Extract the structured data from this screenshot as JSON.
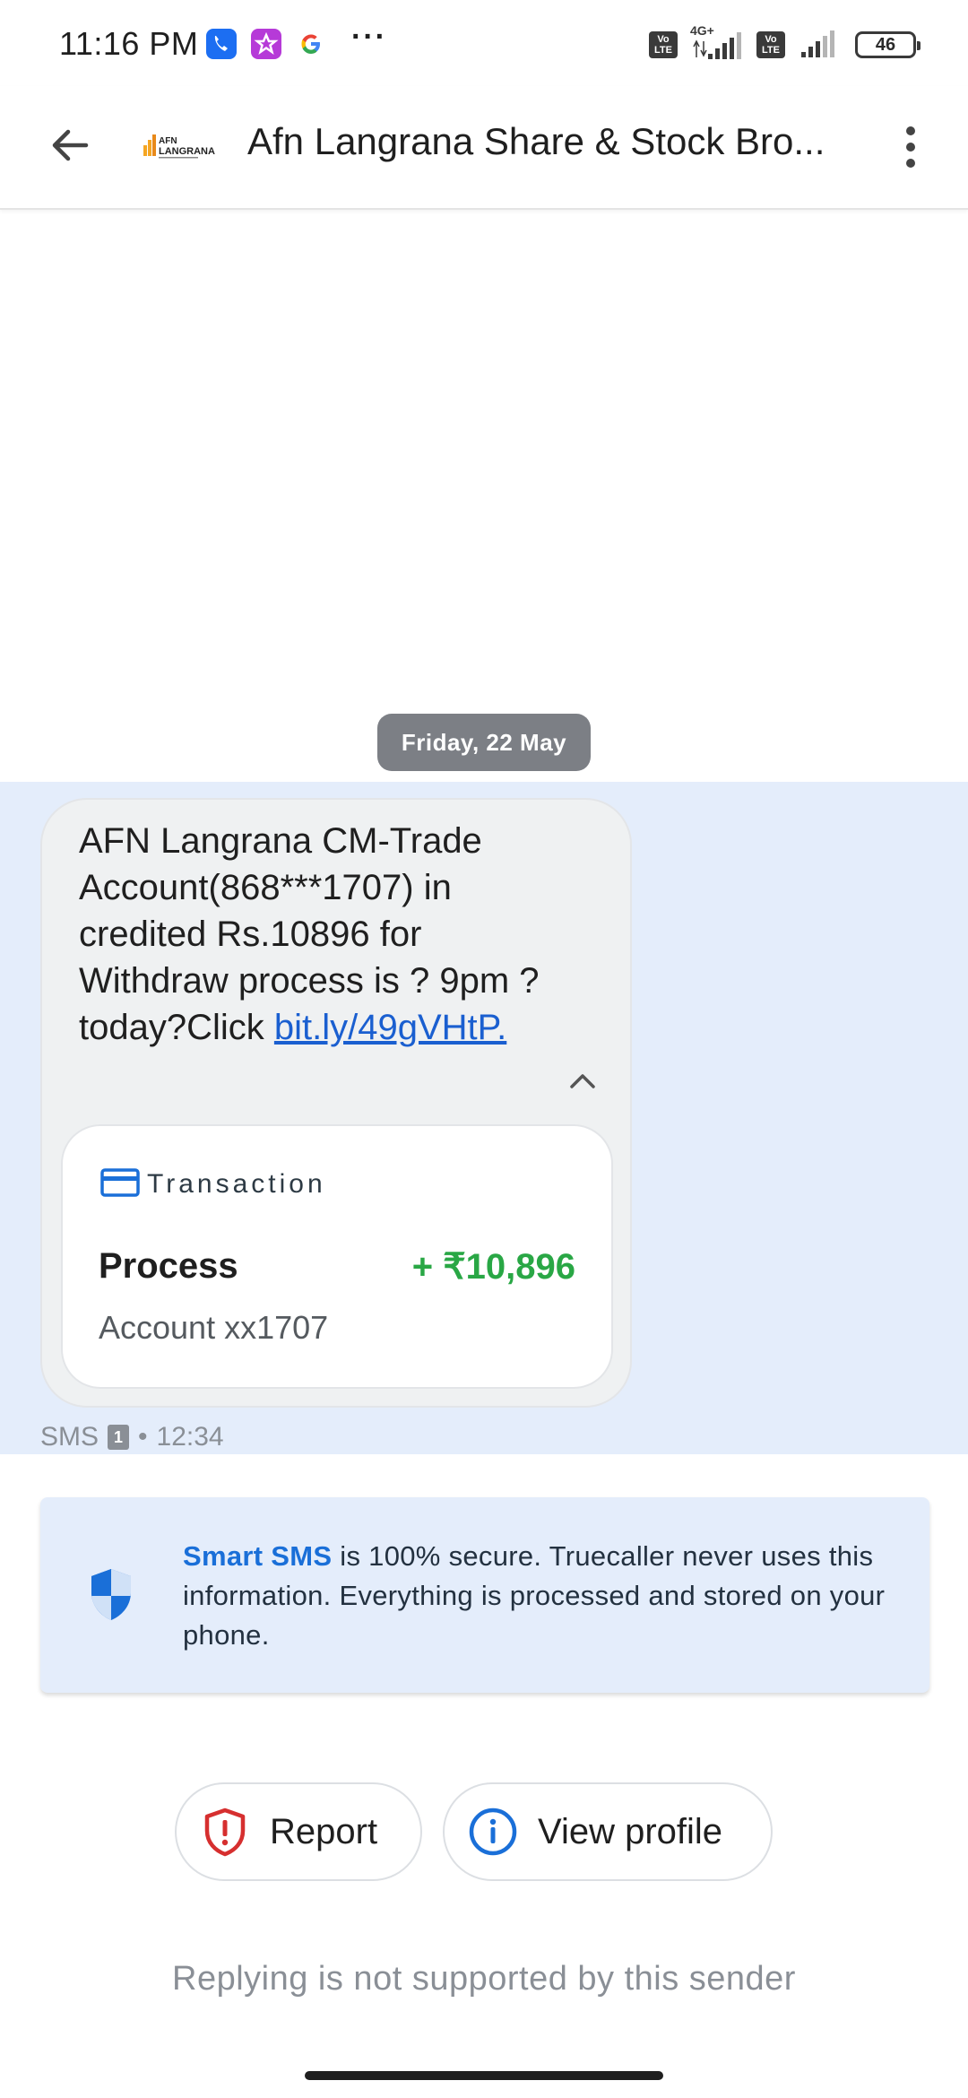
{
  "status_bar": {
    "time": "11:16 PM",
    "network_type": "4G+",
    "volte_label": "Vo LTE",
    "battery": "46",
    "app_icons": [
      "truecaller-call-icon",
      "star-app-icon",
      "google-icon"
    ],
    "overflow": "···"
  },
  "app_bar": {
    "title": "Afn Langrana Share & Stock Bro...",
    "logo_text": "AFN LANGRANA"
  },
  "conversation": {
    "date_chip": "Friday, 22 May",
    "message": {
      "text": "AFN Langrana CM-Trade Account(868***1707) in credited Rs.10896 for Withdraw process is ? 9pm ?today?Click ",
      "link_text": "bit.ly/49gVHtP."
    },
    "transaction_card": {
      "label": "Transaction",
      "title": "Process",
      "amount": "+ ₹10,896",
      "account": "Account xx1707"
    },
    "meta": {
      "channel": "SMS",
      "sim": "1",
      "separator": "•",
      "time": "12:34"
    }
  },
  "smart_sms_notice": {
    "strong": "Smart SMS",
    "text": " is 100% secure. Truecaller never uses this information. Everything is processed and stored on your phone."
  },
  "actions": {
    "report_label": "Report",
    "view_profile_label": "View profile"
  },
  "reply_note": "Replying is not supported by this sender",
  "colors": {
    "accent_blue": "#1a6fd8",
    "link_blue": "#1a5fd0",
    "amount_green": "#29a745",
    "report_red": "#d62f2f",
    "highlight_bg": "#e4edfb"
  }
}
